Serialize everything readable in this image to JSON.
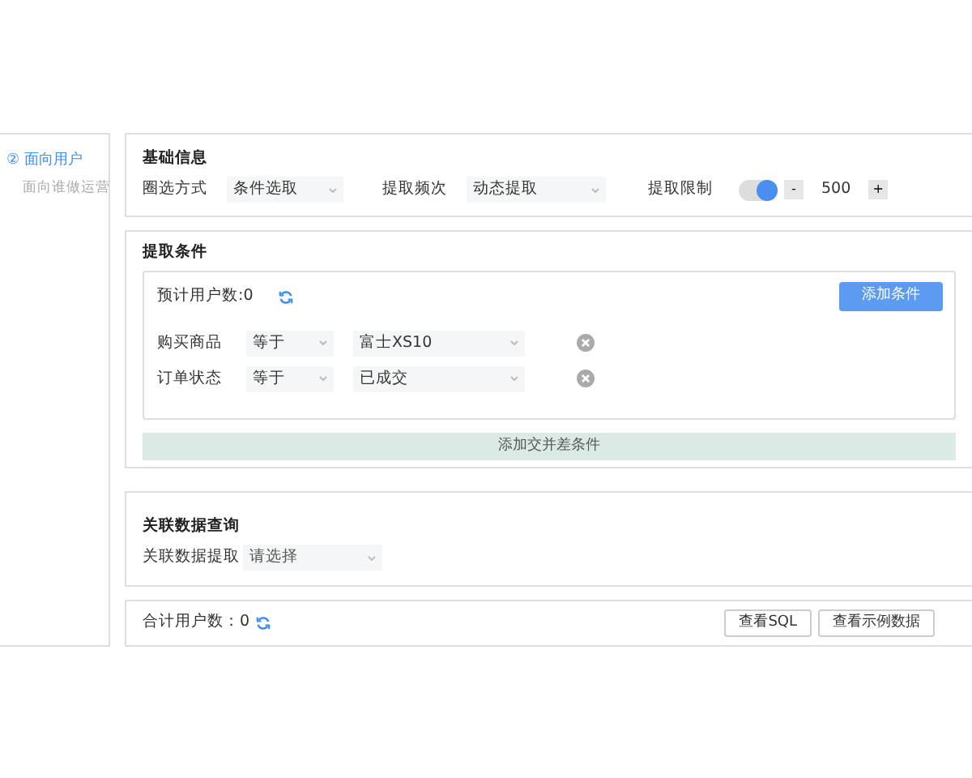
{
  "sidebar": {
    "items": [
      {
        "label": "② 面向用户",
        "selected": true
      },
      {
        "label": "面向谁做运营",
        "selected": false
      }
    ]
  },
  "basic": {
    "title": "基础信息",
    "fields": [
      {
        "label": "圈选方式",
        "value": "条件选取"
      },
      {
        "label": "提取频次",
        "value": "动态提取"
      }
    ],
    "limit": {
      "label": "提取限制",
      "on": true,
      "minus": "-",
      "value": "500",
      "plus": "+"
    }
  },
  "conditions": {
    "title": "提取条件",
    "estimate": "预计用户数:0",
    "add_button": "添加条件",
    "rows": [
      {
        "field": "购买商品",
        "operator": "等于",
        "value": "富士XS10"
      },
      {
        "field": "订单状态",
        "operator": "等于",
        "value": "已成交"
      }
    ],
    "cross_button": "添加交并差条件"
  },
  "related": {
    "title": "关联数据查询",
    "label": "关联数据提取",
    "placeholder": "请选择"
  },
  "footer": {
    "total": "合计用户数：0",
    "buttons": [
      "查看SQL",
      "查看示例数据"
    ]
  }
}
